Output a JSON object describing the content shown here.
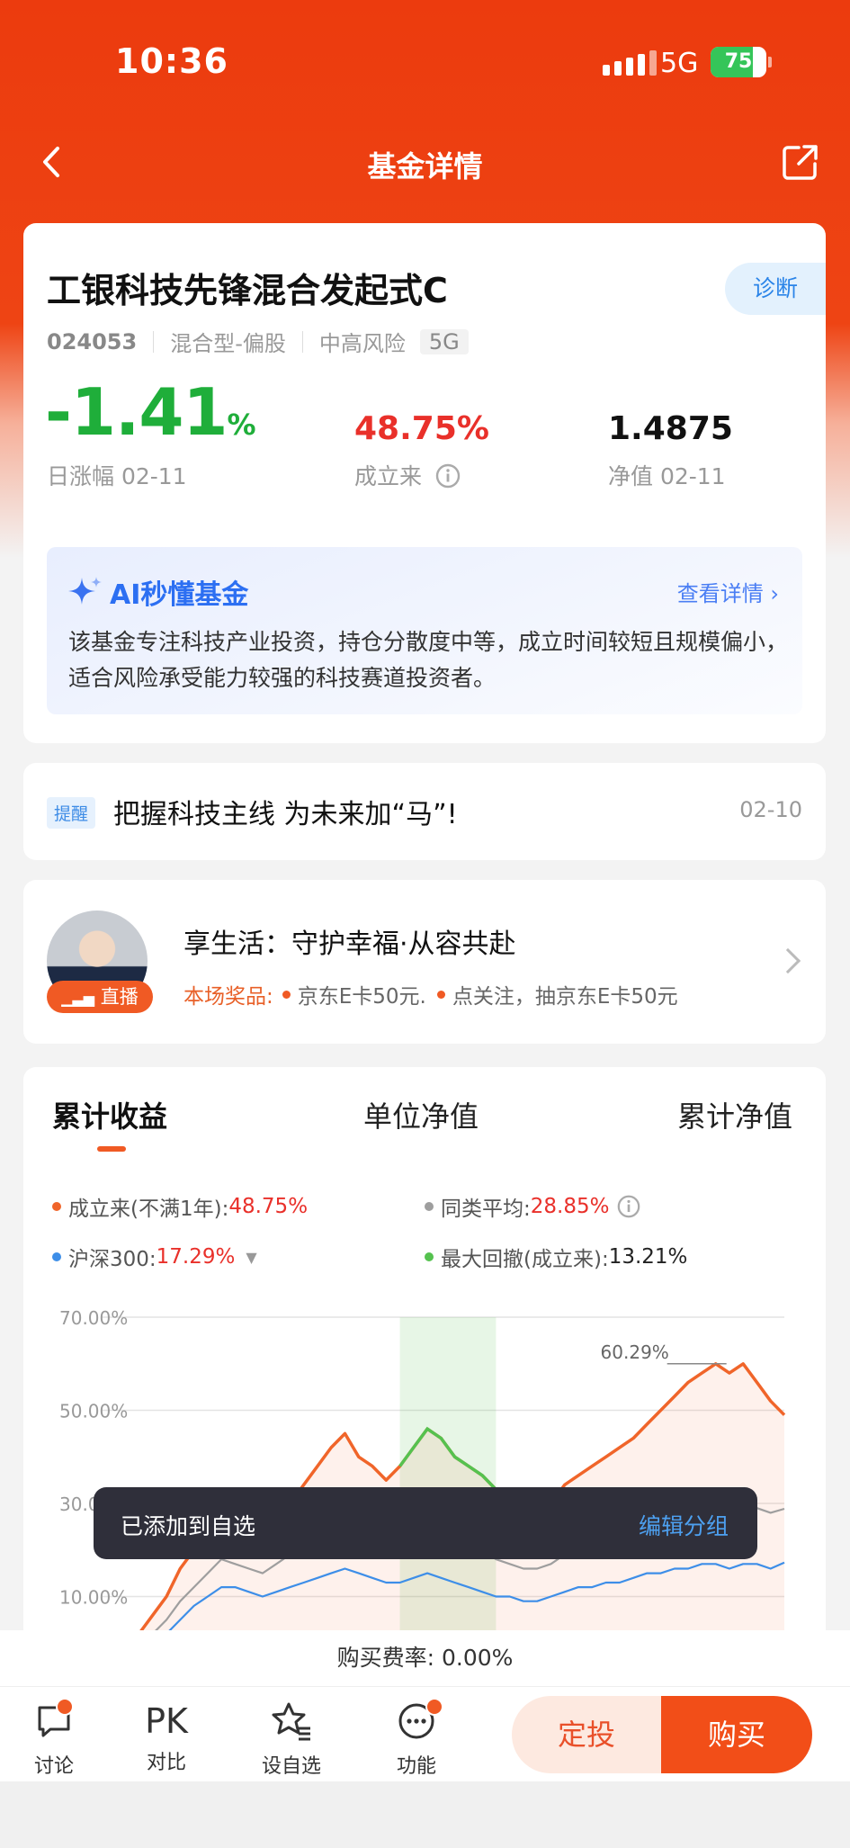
{
  "status_bar": {
    "time": "10:36",
    "network": "5G",
    "battery": "75",
    "battery_level": 0.75
  },
  "nav": {
    "title": "基金详情"
  },
  "fund": {
    "name": "工银科技先锋混合发起式C",
    "diagnose_label": "诊断",
    "code": "024053",
    "type": "混合型-偏股",
    "risk": "中高风险",
    "tag": "5G",
    "daily_change": "-1.41",
    "daily_change_unit": "%",
    "daily_label": "日涨幅 02-11",
    "since_inception": "48.75%",
    "since_inception_label": "成立来",
    "nav_value": "1.4875",
    "nav_label": "净值 02-11"
  },
  "ai": {
    "title": "AI秒懂基金",
    "more": "查看详情",
    "text": "该基金专注科技产业投资，持仓分散度中等，成立时间较短且规模偏小，适合风险承受能力较强的科技赛道投资者。"
  },
  "notice": {
    "tag": "提醒",
    "text": "把握科技主线 为未来加“马”!",
    "date": "02-10"
  },
  "live": {
    "badge": "直播",
    "title": "享生活：守护幸福·从容共赴",
    "prize_label": "本场奖品:",
    "prizes": [
      "京东E卡50元.",
      "点关注，抽京东E卡50元"
    ]
  },
  "chart_tabs": [
    "累计收益",
    "单位净值",
    "累计净值"
  ],
  "legend": {
    "l1_name": "成立来(不满1年):",
    "l1_value": "48.75%",
    "l2_name": "同类平均:",
    "l2_value": "28.85%",
    "l3_name": "沪深300:",
    "l3_value": "17.29%",
    "l4_name": "最大回撤(成立来):",
    "l4_value": "13.21%"
  },
  "colors": {
    "fund": "#f0652a",
    "category_avg": "#9e9e9e",
    "hs300": "#3d8ee8",
    "drawdown": "#55c24f"
  },
  "chart_data": {
    "type": "line",
    "yticks": [
      "70.00%",
      "50.00%",
      "30.00%",
      "10.00%"
    ],
    "ylim": [
      -10,
      70
    ],
    "peak_annotation": "60.29%",
    "grid": true,
    "series": [
      {
        "name": "成立来(不满1年)",
        "values": [
          -4,
          -2,
          2,
          6,
          10,
          16,
          20,
          24,
          29,
          28,
          25,
          22,
          26,
          30,
          34,
          38,
          42,
          45,
          40,
          38,
          35,
          38,
          42,
          46,
          44,
          40,
          38,
          36,
          33,
          30,
          28,
          26,
          30,
          34,
          36,
          38,
          40,
          42,
          44,
          47,
          50,
          53,
          56,
          58,
          60,
          58,
          60,
          56,
          52,
          49
        ]
      },
      {
        "name": "同类平均",
        "values": [
          -4,
          -3,
          0,
          2,
          5,
          9,
          12,
          15,
          18,
          17,
          16,
          15,
          17,
          19,
          22,
          24,
          26,
          27,
          25,
          23,
          21,
          22,
          24,
          25,
          24,
          23,
          22,
          20,
          18,
          17,
          16,
          16,
          17,
          19,
          20,
          21,
          22,
          23,
          24,
          25,
          26,
          27,
          28,
          29,
          30,
          29,
          30,
          29,
          28,
          28.85
        ]
      },
      {
        "name": "沪深300",
        "values": [
          -5,
          -5,
          -3,
          -1,
          2,
          5,
          8,
          10,
          12,
          12,
          11,
          10,
          11,
          12,
          13,
          14,
          15,
          16,
          15,
          14,
          13,
          13,
          14,
          15,
          14,
          13,
          12,
          11,
          10,
          10,
          9,
          9,
          10,
          11,
          12,
          12,
          13,
          13,
          14,
          15,
          15,
          16,
          16,
          17,
          17,
          16,
          17,
          17,
          16,
          17.29
        ]
      }
    ],
    "drawdown_range": [
      21,
      28
    ]
  },
  "toast": {
    "text": "已添加到自选",
    "action": "编辑分组"
  },
  "fee": {
    "text": "购买费率: 0.00%"
  },
  "bottom_bar": {
    "discuss": "讨论",
    "compare_icon": "PK",
    "compare": "对比",
    "watchlist": "设自选",
    "functions": "功能",
    "sip": "定投",
    "buy": "购买"
  }
}
